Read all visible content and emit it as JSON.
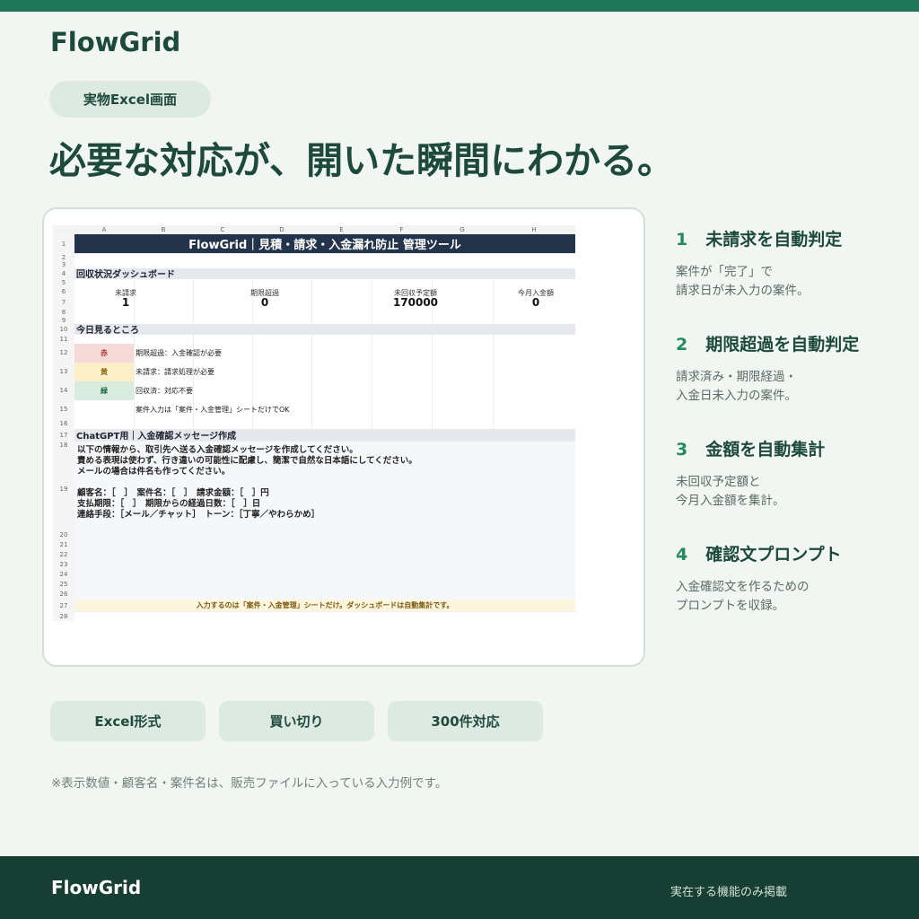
{
  "brand": "FlowGrid",
  "tag": "実物Excel画面",
  "headline": "必要な対応が、開いた瞬間にわかる。",
  "sheet": {
    "columns": [
      "A",
      "B",
      "C",
      "D",
      "E",
      "F",
      "G",
      "H"
    ],
    "rows": [
      "1",
      "2",
      "3",
      "4",
      "5",
      "6",
      "7",
      "8",
      "9",
      "10",
      "11",
      "12",
      "13",
      "14",
      "15",
      "16",
      "17",
      "18",
      "19",
      "20",
      "21",
      "22",
      "23",
      "24",
      "25",
      "26",
      "27",
      "28"
    ],
    "title": "FlowGrid｜見積・請求・入金漏れ防止 管理ツール",
    "dashboard_heading": "回収状況ダッシュボード",
    "kpis": [
      {
        "label": "未請求",
        "value": "1"
      },
      {
        "label": "期限超過",
        "value": "0"
      },
      {
        "label": "未回収予定額",
        "value": "170000"
      },
      {
        "label": "今月入金額",
        "value": "0"
      }
    ],
    "today_heading": "今日見るところ",
    "legend": [
      {
        "swatch": "赤",
        "text": "期限超過：入金確認が必要",
        "bg": "#f6d9d9",
        "fg": "#b03030"
      },
      {
        "swatch": "黄",
        "text": "未請求：請求処理が必要",
        "bg": "#fcefc8",
        "fg": "#8a6a10"
      },
      {
        "swatch": "緑",
        "text": "回収済：対応不要",
        "bg": "#d9ece0",
        "fg": "#2a6a48"
      }
    ],
    "input_note": "案件入力は「案件・入金管理」シートだけでOK",
    "prompt_heading": "ChatGPT用｜入金確認メッセージ作成",
    "prompt_lines": [
      "以下の情報から、取引先へ送る入金確認メッセージを作成してください。",
      "責める表現は使わず、行き違いの可能性に配慮し、簡潔で自然な日本語にしてください。",
      "メールの場合は件名も作ってください。",
      "",
      "顧客名：［　］　案件名：［　］　請求金額：［　］円",
      "支払期限：［　］　期限からの経過日数：［　］日",
      "連絡手段：［メール／チャット］　トーン：［丁寧／やわらかめ］"
    ],
    "footer_note": "入力するのは「案件・入金管理」シートだけ。ダッシュボードは自動集計です。"
  },
  "features": [
    {
      "num": "1",
      "title": "未請求を自動判定",
      "desc": [
        "案件が「完了」で",
        "請求日が未入力の案件。"
      ]
    },
    {
      "num": "2",
      "title": "期限超過を自動判定",
      "desc": [
        "請求済み・期限経過・",
        "入金日未入力の案件。"
      ]
    },
    {
      "num": "3",
      "title": "金額を自動集計",
      "desc": [
        "未回収予定額と",
        "今月入金額を集計。"
      ]
    },
    {
      "num": "4",
      "title": "確認文プロンプト",
      "desc": [
        "入金確認文を作るための",
        "プロンプトを収録。"
      ]
    }
  ],
  "chips": [
    "Excel形式",
    "買い切り",
    "300件対応"
  ],
  "disclaimer": "※表示数値・顧客名・案件名は、販売ファイルに入っている入力例です。",
  "footer": {
    "brand": "FlowGrid",
    "tagline": "実在する機能のみ掲載"
  }
}
